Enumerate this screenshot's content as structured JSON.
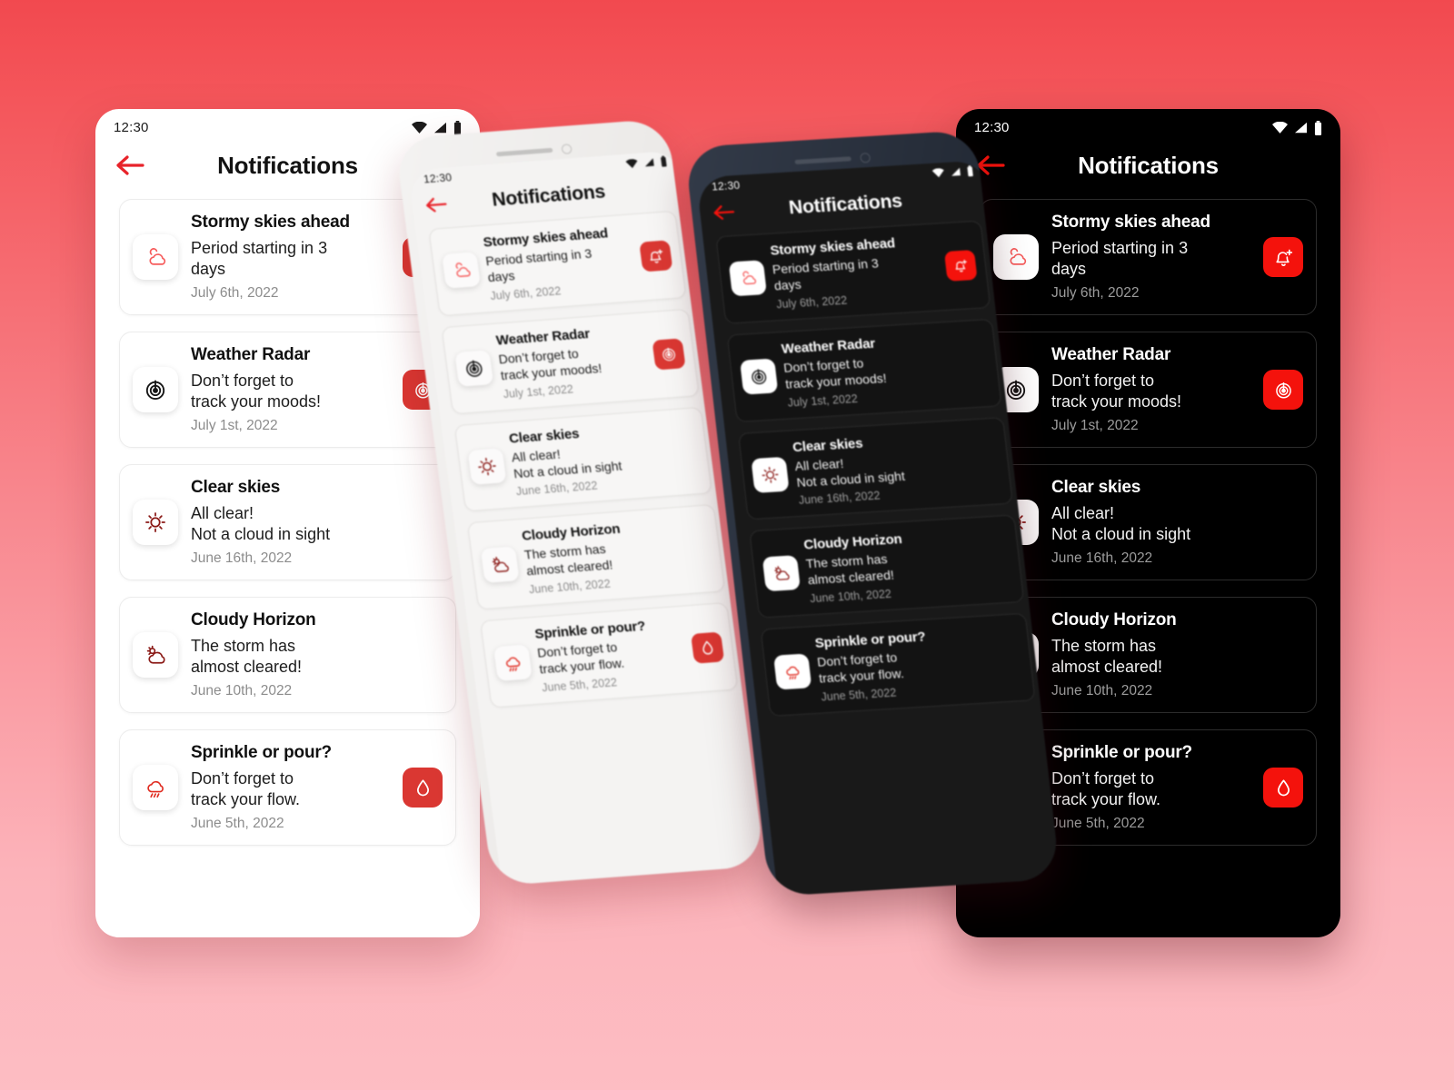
{
  "theme": {
    "background_top": "#F2494F",
    "background_bottom": "#FCB3BA",
    "accent_red": "#DA3732",
    "accent_red_dark_mode": "#F4120C",
    "icon_coral": "#F65B5B",
    "icon_darkred": "#8B1A17",
    "icon_red": "#E02B20"
  },
  "status_bar": {
    "time": "12:30",
    "icons": [
      "wifi-icon",
      "cellular-signal-icon",
      "battery-icon"
    ]
  },
  "app_bar": {
    "back_icon": "arrow-left-icon",
    "title": "Notifications"
  },
  "notifications": [
    {
      "title": "Stormy skies ahead",
      "subtitle": "Period starting in 3\ndays",
      "date": "July 6th, 2022",
      "leading_icon": "clouds-icon",
      "action_icon": "bell-plus-icon",
      "has_action": true
    },
    {
      "title": "Weather Radar",
      "subtitle": "Don’t  forget to\ntrack your moods!",
      "date": "July 1st, 2022",
      "leading_icon": "radar-icon",
      "action_icon": "radar-icon",
      "has_action": true
    },
    {
      "title": "Clear skies",
      "subtitle": "All clear!\nNot a cloud in sight",
      "date": "June 16th, 2022",
      "leading_icon": "sun-icon",
      "action_icon": "",
      "has_action": false
    },
    {
      "title": "Cloudy Horizon",
      "subtitle": "The storm has\nalmost cleared!",
      "date": "June 10th, 2022",
      "leading_icon": "sun-behind-cloud-icon",
      "action_icon": "",
      "has_action": false
    },
    {
      "title": "Sprinkle or pour?",
      "subtitle": "Don’t forget to\ntrack your flow.",
      "date": "June 5th, 2022",
      "leading_icon": "rain-cloud-icon",
      "action_icon": "water-drop-icon",
      "has_action": true
    }
  ]
}
